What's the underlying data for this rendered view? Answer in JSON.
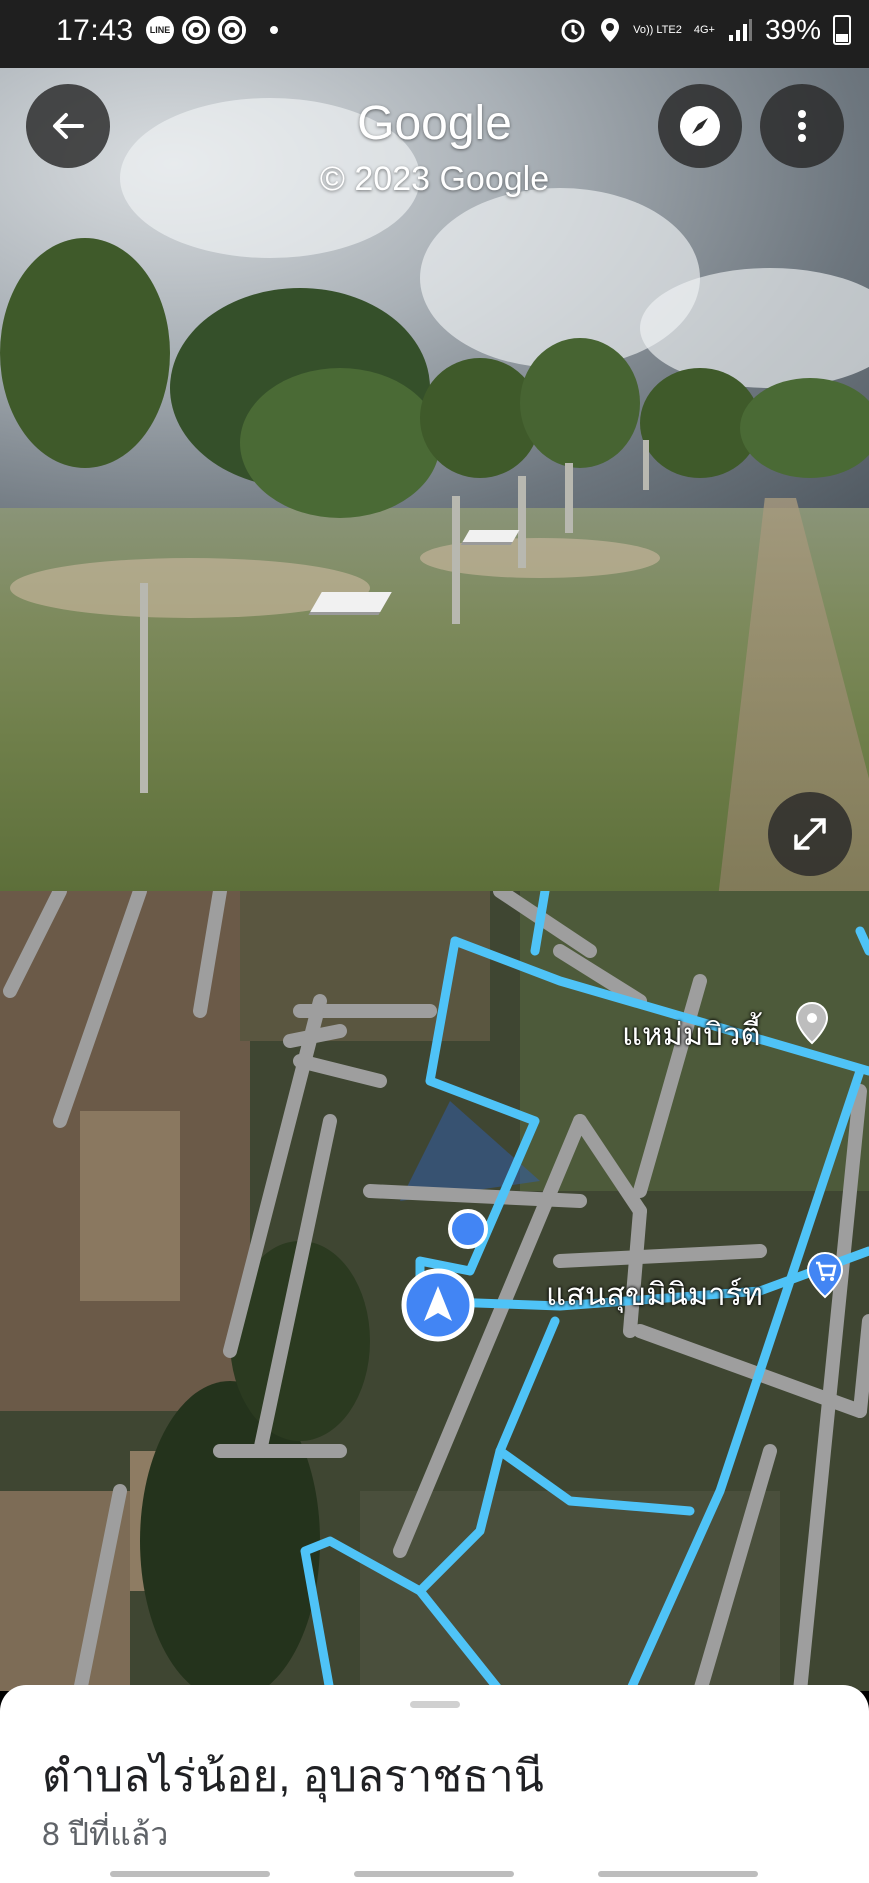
{
  "status_bar": {
    "time": "17:43",
    "left_icons": [
      "line-app-icon",
      "chrome-icon",
      "chrome-icon"
    ],
    "network_top": "Vo)) LTE2",
    "network_gen": "4G+",
    "battery": "39%"
  },
  "street_view": {
    "brand": "Google",
    "copyright": "© 2023 Google"
  },
  "map": {
    "labels": {
      "place1": "แหม่มบิวตี้",
      "place2": "แสนสุขมินิมาร์ท"
    }
  },
  "bottom_sheet": {
    "title": "ตำบลไร่น้อย, อุบลราชธานี",
    "subtitle": "8 ปีที่แล้ว"
  },
  "colors": {
    "route": "#4fc3f7",
    "road": "#9e9e9e",
    "location": "#4285f4"
  }
}
